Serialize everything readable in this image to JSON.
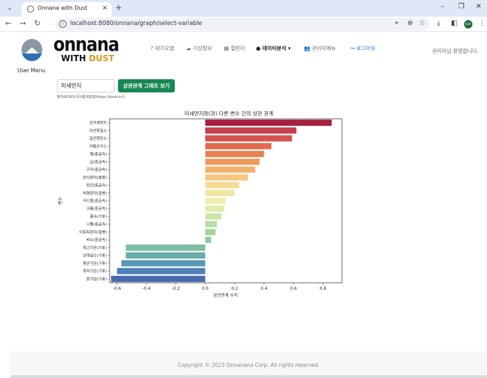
{
  "browser": {
    "tab_title": "Onnana with Dust",
    "url": "localhost:8080/onnana/graph/select-variable",
    "tab_close": "×",
    "new_tab": "+",
    "profile_label": "Juli"
  },
  "header": {
    "brand_line1": "onnana",
    "brand_with": "WITH ",
    "brand_dust": "DUST",
    "user_menu": "User Menu",
    "nav": [
      {
        "label": "? 대기오염"
      },
      {
        "label": "☁ 기상정보"
      },
      {
        "label": "▦ 캘린더"
      },
      {
        "label": "● 데이터분석 ▾"
      },
      {
        "label": "👥 관리자메뉴"
      },
      {
        "label": "↪ 로그아웃"
      }
    ],
    "welcome": "관리자님 환영합니다."
  },
  "form": {
    "variable_value": "미세먼지",
    "button_label": "상관관계 그래프 보기",
    "source_text": "출처(KOSIS(국내통계포털)https://kosis.kr/)"
  },
  "chart_data": {
    "type": "bar",
    "orientation": "horizontal",
    "title": "미세먼지와(과) 다른 변수 간의 상관 관계",
    "xlabel": "상관관계 수치",
    "ylabel": "변수",
    "xlim": [
      -0.65,
      0.93
    ],
    "xticks": [
      "-0.6",
      "-0.4",
      "-0.2",
      "0.0",
      "0.2",
      "0.4",
      "0.6",
      "0.8"
    ],
    "xtick_values": [
      -0.6,
      -0.4,
      -0.2,
      0.0,
      0.2,
      0.4,
      0.6,
      0.8
    ],
    "categories": [
      "초미세먼지",
      "이산화질소",
      "일산화탄소",
      "아황산가스",
      "철(중금속)",
      "납(중금속)",
      "구리(중금속)",
      "천식환자(질병)",
      "망간(중금속)",
      "비염환자(질병)",
      "카드뮴(중금속)",
      "크롬(중금속)",
      "풍속(기후)",
      "니켈(중금속)",
      "아토피환자(질병)",
      "비소(중금속)",
      "최고기온(기후)",
      "상대습도(기후)",
      "평균기온(기후)",
      "최저기온(기후)",
      "증기압(기후)"
    ],
    "values": [
      0.86,
      0.62,
      0.59,
      0.45,
      0.4,
      0.37,
      0.34,
      0.29,
      0.23,
      0.2,
      0.14,
      0.13,
      0.11,
      0.08,
      0.07,
      0.04,
      -0.54,
      -0.54,
      -0.57,
      -0.6,
      -0.64
    ],
    "colors": [
      "#a6213f",
      "#c4404d",
      "#d65350",
      "#e26a4f",
      "#ea8250",
      "#ef9a5c",
      "#f2b36c",
      "#f4c880",
      "#f4da93",
      "#f1e6a2",
      "#ecefae",
      "#e1ecad",
      "#cde5a8",
      "#b8dca3",
      "#a3d3a0",
      "#8dc99f",
      "#7bbfa0",
      "#67adab",
      "#5797b6",
      "#4c82b7",
      "#4a6aac"
    ],
    "grid": false,
    "legend": "none"
  },
  "footer": {
    "text": "Copyright © 2023 Onnanana Corp. All rights reserved."
  }
}
